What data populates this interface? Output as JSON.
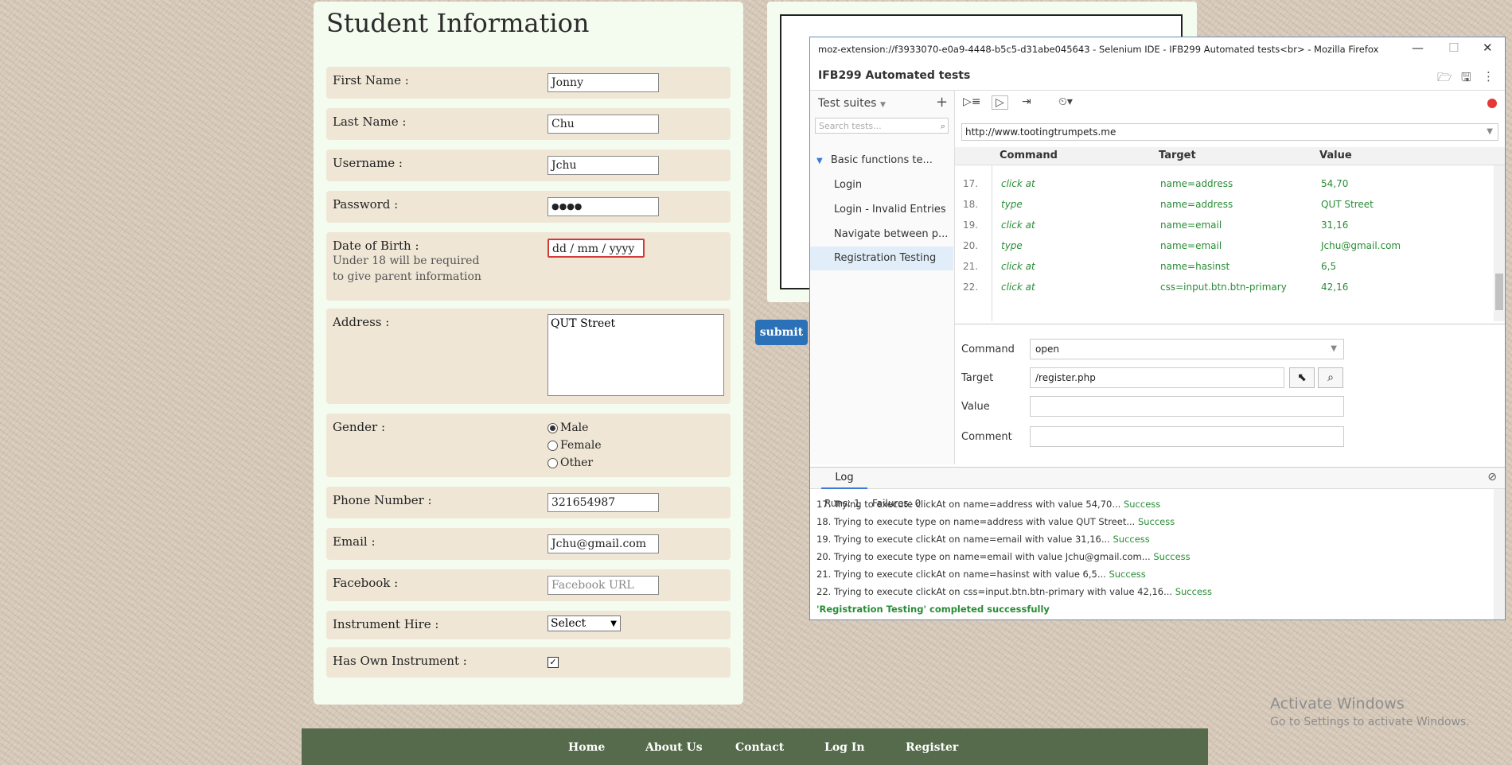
{
  "form": {
    "title": "Student Information",
    "first_name_label": "First Name :",
    "first_name_value": "Jonny",
    "last_name_label": "Last Name :",
    "last_name_value": "Chu",
    "username_label": "Username :",
    "username_value": "Jchu",
    "password_label": "Password :",
    "password_value": "●●●●",
    "dob_label": "Date of Birth :",
    "dob_note_1": "Under 18 will be required",
    "dob_note_2": "to give parent information",
    "dob_value": "dd / mm / yyyy",
    "address_label": "Address :",
    "address_value": "QUT Street",
    "gender_label": "Gender :",
    "gender_options": [
      "Male",
      "Female",
      "Other"
    ],
    "gender_selected": "Male",
    "phone_label": "Phone Number :",
    "phone_value": "321654987",
    "email_label": "Email :",
    "email_value": "Jchu@gmail.com",
    "facebook_label": "Facebook :",
    "facebook_placeholder": "Facebook URL",
    "instrument_label": "Instrument Hire :",
    "instrument_value": "Select",
    "own_instrument_label": "Has Own Instrument :",
    "own_instrument_checked": true,
    "submit_label": "submit"
  },
  "footer": {
    "links": [
      "Home",
      "About Us",
      "Contact",
      "Log In",
      "Register"
    ],
    "color": "#566b4b"
  },
  "activate": {
    "line1": "Activate Windows",
    "line2": "Go to Settings to activate Windows."
  },
  "selenium": {
    "window_title": "moz-extension://f3933070-e0a9-4448-b5c5-d31abe045643 - Selenium IDE - IFB299 Automated tests<br> - Mozilla Firefox",
    "project_name": "IFB299 Automated tests",
    "suites_label": "Test suites",
    "search_placeholder": "Search tests...",
    "suite_name": "Basic functions te...",
    "tests": [
      "Login",
      "Login - Invalid Entries",
      "Navigate between p...",
      "Registration Testing"
    ],
    "selected_test": "Registration Testing",
    "runs": "Runs: 1",
    "failures": "Failures: 0",
    "base_url": "http://www.tootingtrumpets.me",
    "columns": [
      "Command",
      "Target",
      "Value"
    ],
    "commands": [
      {
        "n": "17.",
        "cmd": "click at",
        "target": "name=address",
        "value": "54,70"
      },
      {
        "n": "18.",
        "cmd": "type",
        "target": "name=address",
        "value": "QUT Street"
      },
      {
        "n": "19.",
        "cmd": "click at",
        "target": "name=email",
        "value": "31,16"
      },
      {
        "n": "20.",
        "cmd": "type",
        "target": "name=email",
        "value": "Jchu@gmail.com"
      },
      {
        "n": "21.",
        "cmd": "click at",
        "target": "name=hasinst",
        "value": "6,5"
      },
      {
        "n": "22.",
        "cmd": "click at",
        "target": "css=input.btn.btn-primary",
        "value": "42,16"
      }
    ],
    "editor": {
      "command_label": "Command",
      "command_value": "open",
      "target_label": "Target",
      "target_value": "/register.php",
      "value_label": "Value",
      "value_value": "",
      "comment_label": "Comment",
      "comment_value": ""
    },
    "log_tab": "Log",
    "log": [
      {
        "text": "17. Trying to execute clickAt on name=address with value 54,70...",
        "status": "Success"
      },
      {
        "text": "18. Trying to execute type on name=address with value QUT Street...",
        "status": "Success"
      },
      {
        "text": "19. Trying to execute clickAt on name=email with value 31,16...",
        "status": "Success"
      },
      {
        "text": "20. Trying to execute type on name=email with value Jchu@gmail.com...",
        "status": "Success"
      },
      {
        "text": "21. Trying to execute clickAt on name=hasinst with value 6,5...",
        "status": "Success"
      },
      {
        "text": "22. Trying to execute clickAt on css=input.btn.btn-primary with value 42,16...",
        "status": "Success"
      }
    ],
    "log_done": "'Registration Testing' completed successfully"
  }
}
